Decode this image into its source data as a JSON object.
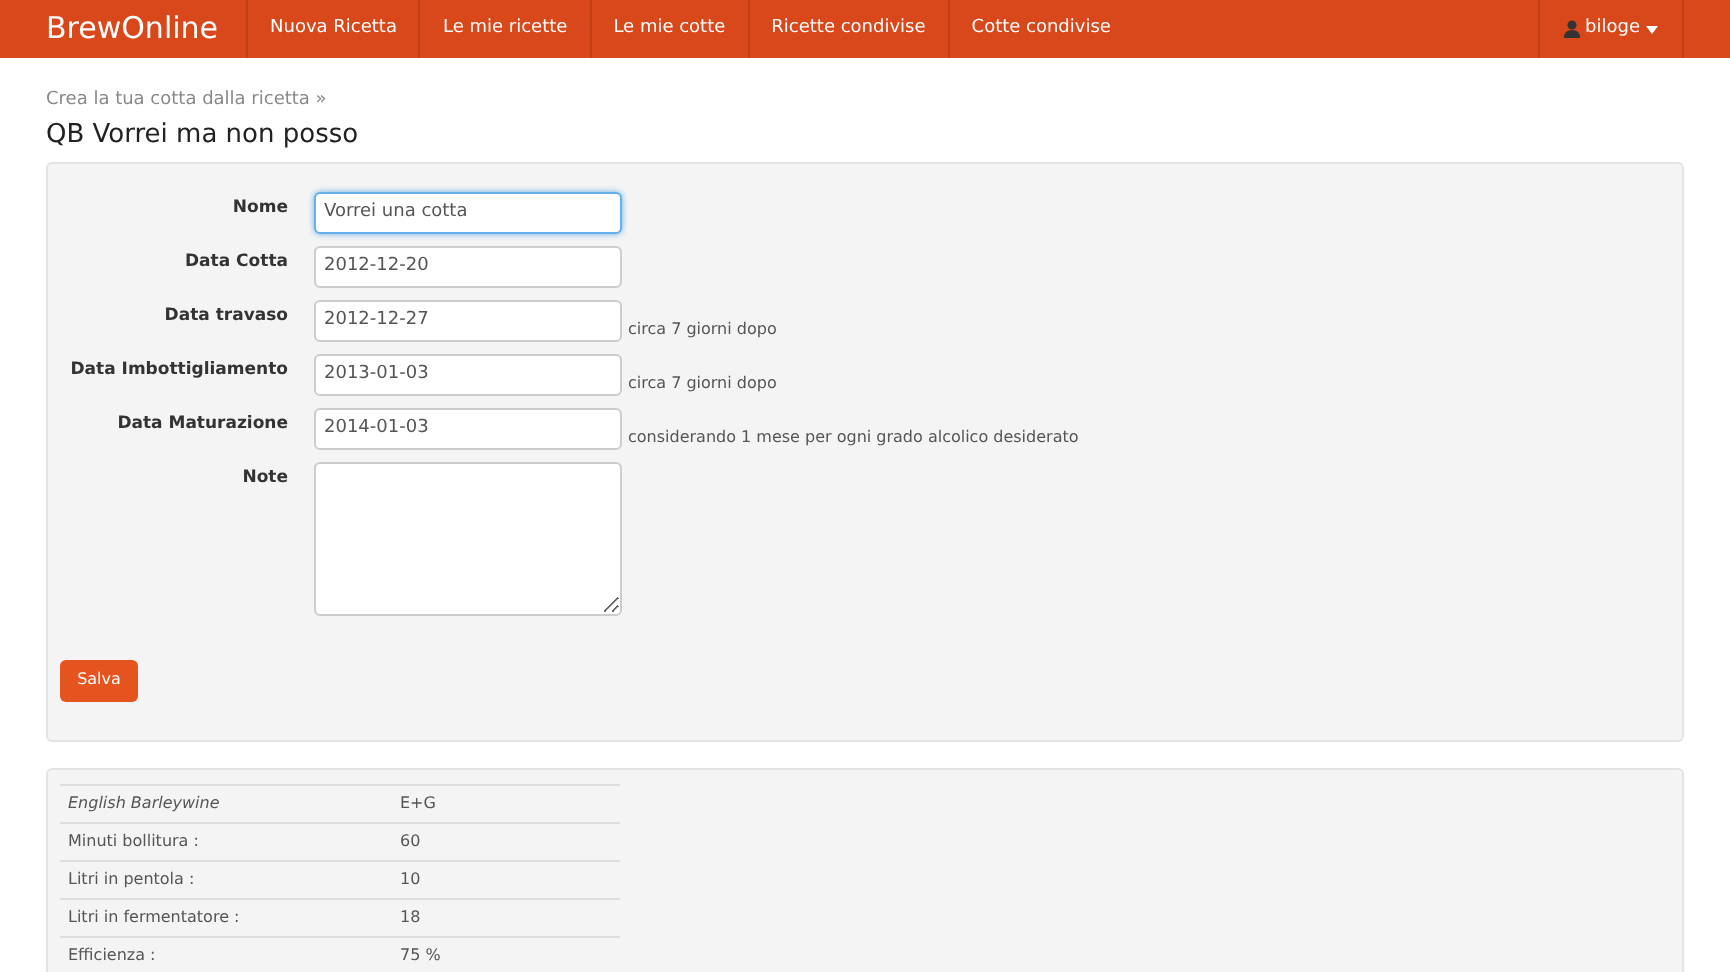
{
  "navbar": {
    "brand": "BrewOnline",
    "items": [
      "Nuova Ricetta",
      "Le mie ricette",
      "Le mie cotte",
      "Ricette condivise",
      "Cotte condivise"
    ],
    "user": "biloge"
  },
  "breadcrumb": "Crea la tua cotta dalla ricetta »",
  "title": "QB Vorrei ma non posso",
  "form": {
    "fields": [
      {
        "kind": "input",
        "label": "Nome",
        "value": "Vorrei una cotta",
        "focused": true
      },
      {
        "kind": "input",
        "label": "Data Cotta",
        "value": "2012-12-20",
        "focused": false
      },
      {
        "kind": "input",
        "label": "Data travaso",
        "value": "2012-12-27",
        "focused": false,
        "help": "circa 7 giorni dopo"
      },
      {
        "kind": "input",
        "label": "Data Imbottigliamento",
        "value": "2013-01-03",
        "focused": false,
        "help": "circa 7 giorni dopo"
      },
      {
        "kind": "input",
        "label": "Data Maturazione",
        "value": "2014-01-03",
        "focused": false,
        "help": "considerando 1 mese per ogni grado alcolico desiderato"
      },
      {
        "kind": "textarea",
        "label": "Note",
        "focused": false
      }
    ],
    "submit": "Salva"
  },
  "recipe_table": {
    "rows": [
      {
        "kind": "style",
        "label": "English Barleywine",
        "value": "E+G"
      },
      {
        "kind": "param",
        "label": "Minuti bollitura :",
        "value": "60"
      },
      {
        "kind": "param",
        "label": "Litri in pentola :",
        "value": "10"
      },
      {
        "kind": "param",
        "label": "Litri in fermentatore :",
        "value": "18"
      },
      {
        "kind": "param",
        "label": "Efficienza :",
        "value": "75 %"
      }
    ]
  }
}
